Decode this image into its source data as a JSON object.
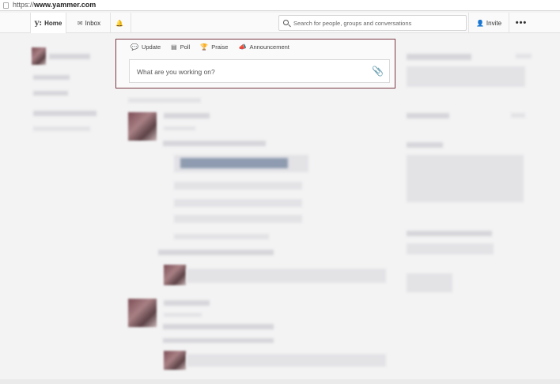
{
  "browser": {
    "url_prefix": "https://",
    "url_host": "www.yammer.com"
  },
  "nav": {
    "logo_text": "y:",
    "home_label": "Home",
    "inbox_label": "Inbox",
    "search_placeholder": "Search for people, groups and conversations",
    "invite_label": "Invite",
    "more_label": "•••"
  },
  "composer": {
    "tabs": [
      {
        "label": "Update",
        "icon": "speech-bubble-icon"
      },
      {
        "label": "Poll",
        "icon": "poll-icon"
      },
      {
        "label": "Praise",
        "icon": "trophy-icon"
      },
      {
        "label": "Announcement",
        "icon": "megaphone-icon"
      }
    ],
    "placeholder": "What are you working on?"
  },
  "colors": {
    "composer_border": "#7a3b45",
    "background": "#f3f3f4"
  }
}
